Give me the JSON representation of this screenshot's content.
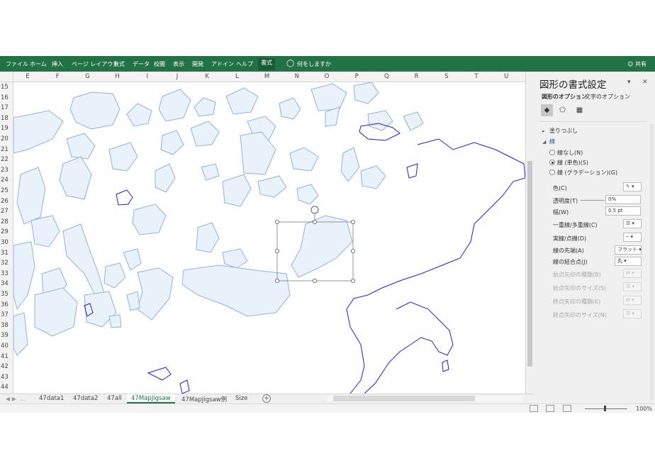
{
  "ribbon": {
    "tabs": [
      "ファイル",
      "ホーム",
      "挿入",
      "ページ レイアウト",
      "数式",
      "データ",
      "校閲",
      "表示",
      "開発",
      "アドイン",
      "ヘルプ"
    ],
    "active_tab": "書式",
    "search_placeholder": "何をしますか",
    "share_label": "共有"
  },
  "columns": [
    "E",
    "F",
    "G",
    "H",
    "I",
    "J",
    "K",
    "L",
    "M",
    "N",
    "O",
    "P",
    "Q",
    "R",
    "S",
    "T",
    "U"
  ],
  "rows": [
    "15",
    "16",
    "17",
    "18",
    "19",
    "20",
    "21",
    "22",
    "23",
    "24",
    "25",
    "26",
    "27",
    "28",
    "29",
    "30",
    "31",
    "32",
    "33",
    "34",
    "35",
    "36",
    "37",
    "38",
    "39",
    "40",
    "41",
    "42",
    "43",
    "44"
  ],
  "sheets": {
    "tabs": [
      "47data1",
      "47data2",
      "47all",
      "47MapJigsaw",
      "47MapJigsaw例",
      "Size"
    ],
    "active": "47MapJigsaw"
  },
  "statusbar": {
    "zoom": "100%"
  },
  "format_pane": {
    "title": "図形の書式設定",
    "option_tabs": [
      "図形のオプション",
      "文字のオプション"
    ],
    "sections": {
      "fill": "塗りつぶし",
      "line": "線"
    },
    "line_options": [
      "線なし(N)",
      "線 (単色)(S)",
      "線 (グラデーション)(G)"
    ],
    "selected_line_option": "線 (単色)(S)",
    "properties": {
      "color": "色(C)",
      "transparency": "透明度(T)",
      "transparency_value": "0%",
      "width": "幅(W)",
      "width_value": "0.5 pt",
      "compound": "一重線/多重線(C)",
      "dash": "実線/点線(D)",
      "cap": "線の先端(A)",
      "cap_value": "フラット",
      "join": "線の結合点(J)",
      "join_value": "丸",
      "begin_arrow_type": "始点矢印の種類(B)",
      "begin_arrow_size": "始点矢印のサイズ(S)",
      "end_arrow_type": "終点矢印の種類(E)",
      "end_arrow_size": "終点矢印のサイズ(N)"
    },
    "colors": {
      "line_color": "#3a4fa0",
      "ribbon": "#217346"
    }
  },
  "shapes": {
    "fill_color": "#e9f1fa",
    "stroke_color": "#8fb4d8",
    "outline_color": "#1f1fd6"
  }
}
